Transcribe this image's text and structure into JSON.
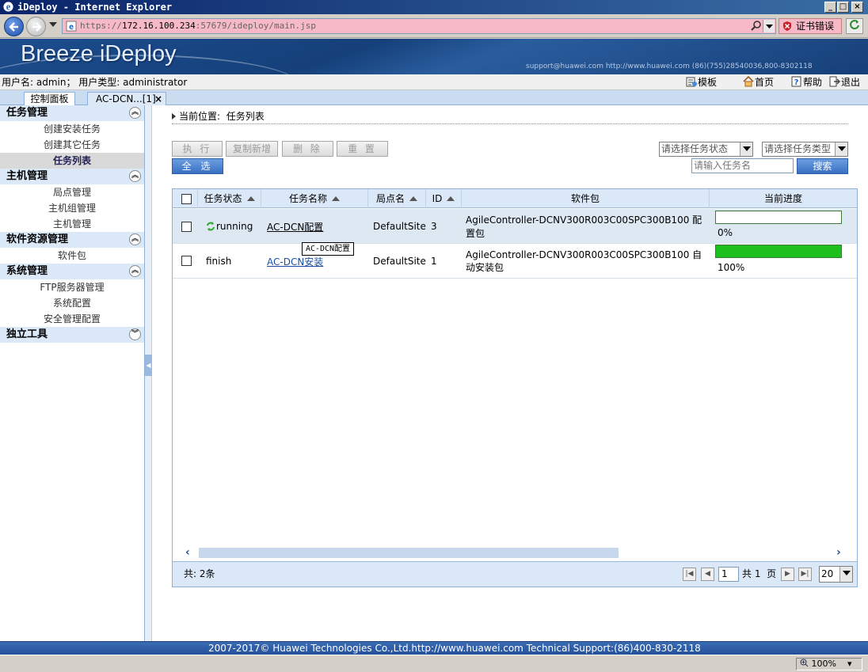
{
  "window": {
    "title": "iDeploy - Internet Explorer"
  },
  "browser": {
    "url_prefix": "https://",
    "url_host": "172.16.100.234",
    "url_rest": ":57679/ideploy/main.jsp",
    "cert_error": "证书错误",
    "zoom": "100%"
  },
  "banner": {
    "logo": "Breeze iDeploy",
    "contact": "support@huawei.com   http://www.huawei.com   (86)(755)28540036,800-8302118"
  },
  "userbar": {
    "user_text": "用户名: admin； 用户类型: administrator",
    "links": {
      "template": "模板",
      "home": "首页",
      "help": "帮助",
      "logout": "退出"
    }
  },
  "tabs": [
    {
      "label": "控制面板"
    },
    {
      "label": "AC-DCN...[1]"
    }
  ],
  "sidebar": {
    "sections": [
      {
        "title": "任务管理",
        "items": [
          "创建安装任务",
          "创建其它任务",
          "任务列表"
        ]
      },
      {
        "title": "主机管理",
        "items": [
          "局点管理",
          "主机组管理",
          "主机管理"
        ]
      },
      {
        "title": "软件资源管理",
        "items": [
          "软件包"
        ]
      },
      {
        "title": "系统管理",
        "items": [
          "FTP服务器管理",
          "系统配置",
          "安全管理配置"
        ]
      },
      {
        "title": "独立工具",
        "items": []
      }
    ],
    "active_item": "任务列表"
  },
  "breadcrumb": {
    "label": "当前位置:",
    "value": "任务列表"
  },
  "toolbar": {
    "execute": "执 行",
    "copy_new": "复制新增",
    "delete": "删 除",
    "reset": "重 置",
    "select_all": "全 选",
    "status_select": "请选择任务状态",
    "type_select": "请选择任务类型",
    "name_placeholder": "请输入任务名",
    "search": "搜索"
  },
  "grid": {
    "columns": [
      "任务状态",
      "任务名称",
      "局点名",
      "ID",
      "软件包",
      "当前进度"
    ],
    "rows": [
      {
        "status": "running",
        "name": "AC-DCN配置",
        "site": "DefaultSite",
        "id": "3",
        "package": "AgileController-DCNV300R003C00SPC300B100 配置包",
        "progress_text": "0%",
        "progress": 0
      },
      {
        "status": "finish",
        "name": "AC-DCN安装",
        "site": "DefaultSite",
        "id": "1",
        "package": "AgileController-DCNV300R003C00SPC300B100 自动安装包",
        "progress_text": "100%",
        "progress": 100
      }
    ],
    "tooltip": "AC-DCN配置",
    "total": "共: 2条",
    "page": "1",
    "page_total_pre": "共",
    "page_total_num": "1",
    "page_total_post": "页",
    "page_size": "20"
  },
  "footer": {
    "text": "2007-2017© Huawei Technologies Co.,Ltd.http://www.huawei.com    Technical Support:(86)400-830-2118"
  },
  "colors": {
    "accent": "#3a70c4",
    "progress": "#1ec01e",
    "url_error_bg": "#f7b8c7"
  }
}
